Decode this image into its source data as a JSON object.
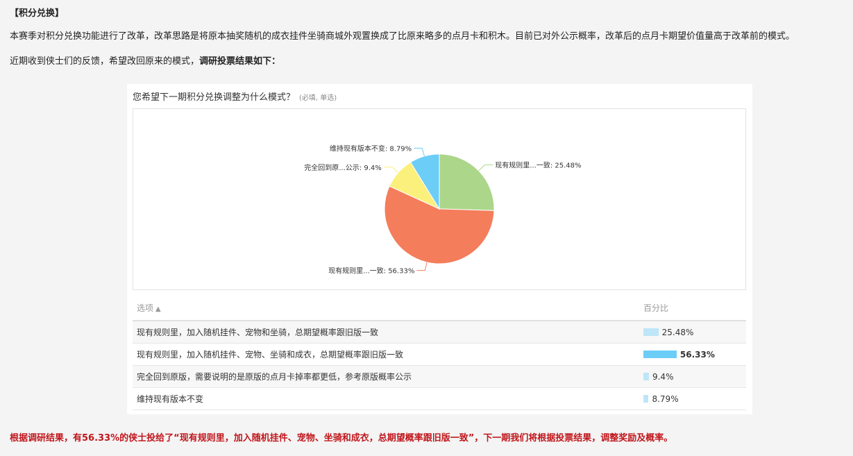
{
  "section_title": "【积分兑换】",
  "paragraph1": "本赛季对积分兑换功能进行了改革，改革思路是将原本抽奖随机的成衣挂件坐骑商城外观置换成了比原来略多的点月卡和积木。目前已对外公示概率，改革后的点月卡期望价值量高于改革前的模式。",
  "paragraph2_prefix": "近期收到侠士们的反馈，希望改回原来的模式，",
  "paragraph2_bold": "调研投票结果如下：",
  "survey": {
    "question": "您希望下一期积分兑换调整为什么模式？",
    "question_note": "(必填, 单选)",
    "table_header_option": "选项",
    "table_header_sort_icon": "arrow-up-icon",
    "table_header_percent": "百分比",
    "rows": [
      {
        "option": "现有规则里，加入随机挂件、宠物和坐骑，总期望概率跟旧版一致",
        "percent_label": "25.48%",
        "percent": 25.48,
        "bar_color": "#bde6f8",
        "highlight": false
      },
      {
        "option": "现有规则里，加入随机挂件、宠物、坐骑和成衣，总期望概率跟旧版一致",
        "percent_label": "56.33%",
        "percent": 56.33,
        "bar_color": "#6ccdf7",
        "highlight": true
      },
      {
        "option": "完全回到原版，需要说明的是原版的点月卡掉率都更低，参考原版概率公示",
        "percent_label": "9.4%",
        "percent": 9.4,
        "bar_color": "#bde6f8",
        "highlight": false
      },
      {
        "option": "维持现有版本不变",
        "percent_label": "8.79%",
        "percent": 8.79,
        "bar_color": "#bde6f8",
        "highlight": false
      }
    ]
  },
  "chart_data": {
    "type": "pie",
    "slices": [
      {
        "label": "现有规则里...一致",
        "value": 25.48,
        "display": "现有规则里...一致: 25.48%",
        "color": "#acd68a"
      },
      {
        "label": "现有规则里...一致",
        "value": 56.33,
        "display": "现有规则里...一致: 56.33%",
        "color": "#f47d5b"
      },
      {
        "label": "完全回到原...公示",
        "value": 9.4,
        "display": "完全回到原...公示: 9.4%",
        "color": "#fbf07c"
      },
      {
        "label": "维持现有版本不变",
        "value": 8.79,
        "display": "维持现有版本不变: 8.79%",
        "color": "#6ccdf7"
      }
    ]
  },
  "footer_text": "根据调研结果，有56.33%的侠士投给了“现有规则里，加入随机挂件、宠物、坐骑和成衣，总期望概率跟旧版一致”，下一期我们将根据投票结果，调整奖励及概率。"
}
